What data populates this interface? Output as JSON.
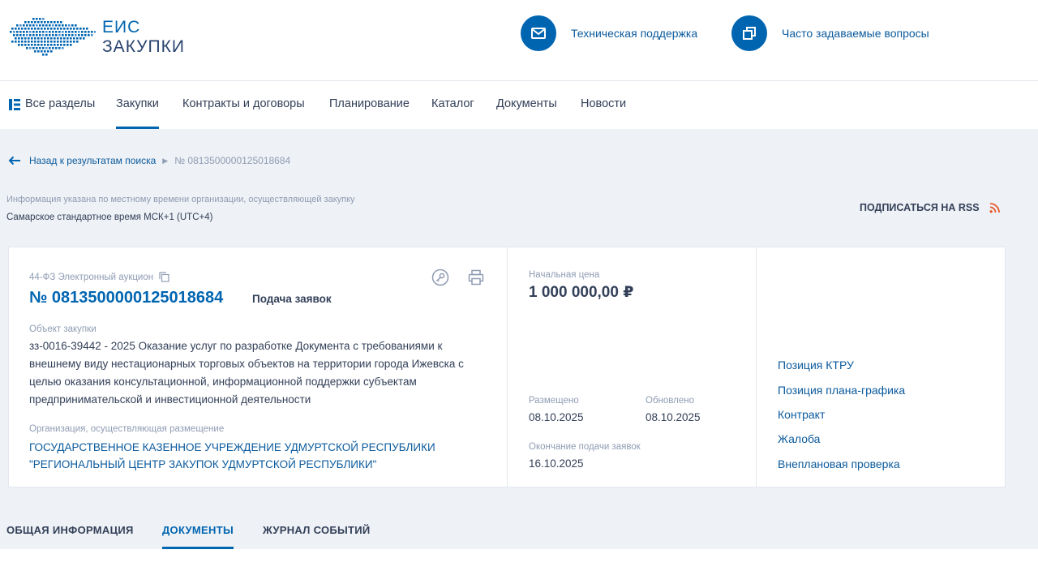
{
  "header": {
    "logo_line1": "ЕИС",
    "logo_line2": "ЗАКУПКИ",
    "support_label": "Техническая поддержка",
    "faq_label": "Часто задаваемые вопросы",
    "icons": {
      "support": "mail-icon",
      "faq": "copy-windows-icon"
    },
    "accent_color": "#0065b1"
  },
  "nav": {
    "all_sections": "Все разделы",
    "items": [
      "Закупки",
      "Контракты и договоры",
      "Планирование",
      "Каталог",
      "Документы",
      "Новости"
    ],
    "active": "Закупки"
  },
  "breadcrumb": {
    "back_label": "Назад к результатам поиска",
    "current": "№ 0813500000125018684"
  },
  "timezone": {
    "note": "Информация указана по местному времени организации, осуществляющей закупку",
    "value": "Самарское стандартное время МСК+1 (UTC+4)"
  },
  "rss": {
    "label": "ПОДПИСАТЬСЯ НА RSS",
    "icon": "rss-icon",
    "icon_color": "#e8562a"
  },
  "purchase": {
    "type_line": "44-ФЗ Электронный аукцион",
    "number": "№ 0813500000125018684",
    "stage": "Подача заявок",
    "object_label": "Объект закупки",
    "object_text": "зз-0016-39442 - 2025 Оказание услуг по разработке Документа с требованиями к внешнему виду нестационарных торговых объектов на территории города Ижевска с целью оказания консультационной, информационной поддержки субъектам предпринимательской и инвестиционной деятельности",
    "org_label": "Организация, осуществляющая размещение",
    "org_name": "ГОСУДАРСТВЕННОЕ КАЗЕННОЕ УЧРЕЖДЕНИЕ УДМУРТСКОЙ РЕСПУБЛИКИ \"РЕГИОНАЛЬНЫЙ ЦЕНТР ЗАКУПОК УДМУРТСКОЙ РЕСПУБЛИКИ\"",
    "price_label": "Начальная цена",
    "price": "1 000 000,00 ₽",
    "posted_label": "Размещено",
    "posted": "08.10.2025",
    "updated_label": "Обновлено",
    "updated": "08.10.2025",
    "deadline_label": "Окончание подачи заявок",
    "deadline": "16.10.2025",
    "links": [
      "Позиция КТРУ",
      "Позиция плана-графика",
      "Контракт",
      "Жалоба",
      "Внеплановая проверка"
    ]
  },
  "tabs": {
    "items": [
      "ОБЩАЯ ИНФОРМАЦИЯ",
      "ДОКУМЕНТЫ",
      "ЖУРНАЛ СОБЫТИЙ"
    ],
    "active": "ДОКУМЕНТЫ"
  }
}
